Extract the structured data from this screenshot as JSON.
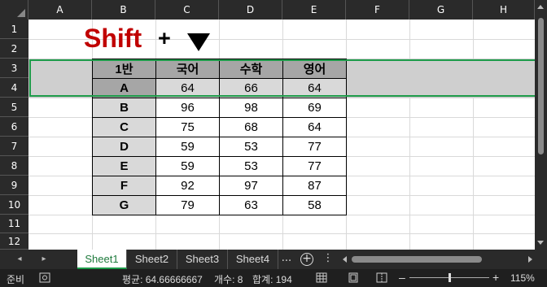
{
  "columns": [
    "A",
    "B",
    "C",
    "D",
    "E",
    "F",
    "G",
    "H"
  ],
  "rows": [
    "1",
    "2",
    "3",
    "4",
    "5",
    "6",
    "7",
    "8",
    "9",
    "10",
    "11",
    "12"
  ],
  "annotation": {
    "shift": "Shift",
    "plus": "+"
  },
  "table": {
    "header": [
      "1반",
      "국어",
      "수학",
      "영어"
    ],
    "students": [
      {
        "name": "A",
        "scores": [
          "64",
          "66",
          "64"
        ]
      },
      {
        "name": "B",
        "scores": [
          "96",
          "98",
          "69"
        ]
      },
      {
        "name": "C",
        "scores": [
          "75",
          "68",
          "64"
        ]
      },
      {
        "name": "D",
        "scores": [
          "59",
          "53",
          "77"
        ]
      },
      {
        "name": "E",
        "scores": [
          "59",
          "53",
          "77"
        ]
      },
      {
        "name": "F",
        "scores": [
          "92",
          "97",
          "87"
        ]
      },
      {
        "name": "G",
        "scores": [
          "79",
          "63",
          "58"
        ]
      }
    ]
  },
  "tabs": {
    "items": [
      "Sheet1",
      "Sheet2",
      "Sheet3",
      "Sheet4"
    ],
    "active": "Sheet1",
    "more": "...",
    "menu": "⋮"
  },
  "status": {
    "ready": "준비",
    "average": "평균: 64.66666667",
    "count": "개수: 8",
    "sum": "합계: 194",
    "zoom": "115%"
  },
  "colors": {
    "selection_border": "#1e9c4a",
    "shift_text": "#c00000",
    "header_fill": "#a6a6a6",
    "label_fill": "#d9d9d9"
  }
}
